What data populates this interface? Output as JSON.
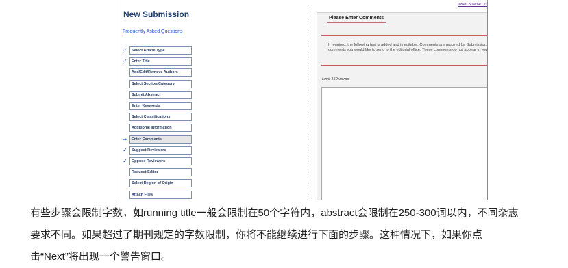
{
  "screenshot": {
    "top_link": "Insert Special Character",
    "sidebar": {
      "title": "New Submission",
      "faq_link": "Frequently Asked Questions",
      "steps": [
        {
          "label": "Select Article Type",
          "state": "done"
        },
        {
          "label": "Enter Title",
          "state": "done"
        },
        {
          "label": "Add/Edit/Remove Authors",
          "state": "none"
        },
        {
          "label": "Select Section/Category",
          "state": "none"
        },
        {
          "label": "Submit Abstract",
          "state": "none"
        },
        {
          "label": "Enter Keywords",
          "state": "none"
        },
        {
          "label": "Select Classifications",
          "state": "none"
        },
        {
          "label": "Additional Information",
          "state": "none"
        },
        {
          "label": "Enter Comments",
          "state": "current"
        },
        {
          "label": "Suggest Reviewers",
          "state": "done"
        },
        {
          "label": "Oppose Reviewers",
          "state": "done"
        },
        {
          "label": "Request Editor",
          "state": "none"
        },
        {
          "label": "Select Region of Origin",
          "state": "none"
        },
        {
          "label": "Attach Files",
          "state": "none"
        }
      ]
    },
    "main": {
      "section_title": "Please Enter Comments",
      "instructions": "If required, the following text is added and is editable: Comments are required for Submission. Enter any comments you would like to send to the editorial office. These comments do not appear in your manuscript.",
      "limit_label": "Limit 150 words",
      "comments_value": ""
    },
    "icons": {
      "done": "checkmark-icon",
      "current": "arrow-right-icon"
    },
    "colors": {
      "accent": "#2c56c2",
      "title": "#1f3f73",
      "rule": "#c85c5c"
    }
  },
  "caption": {
    "line1": "有些步骤会限制字数，如running title一般会限制在50个字符内，abstract会限制在250-300词以内，不同杂志",
    "line2": "要求不同。如果超过了期刊规定的字数限制，你将不能继续进行下面的步骤。这种情况下，如果你点",
    "line3": "击“Next”将出现一个警告窗口。"
  }
}
